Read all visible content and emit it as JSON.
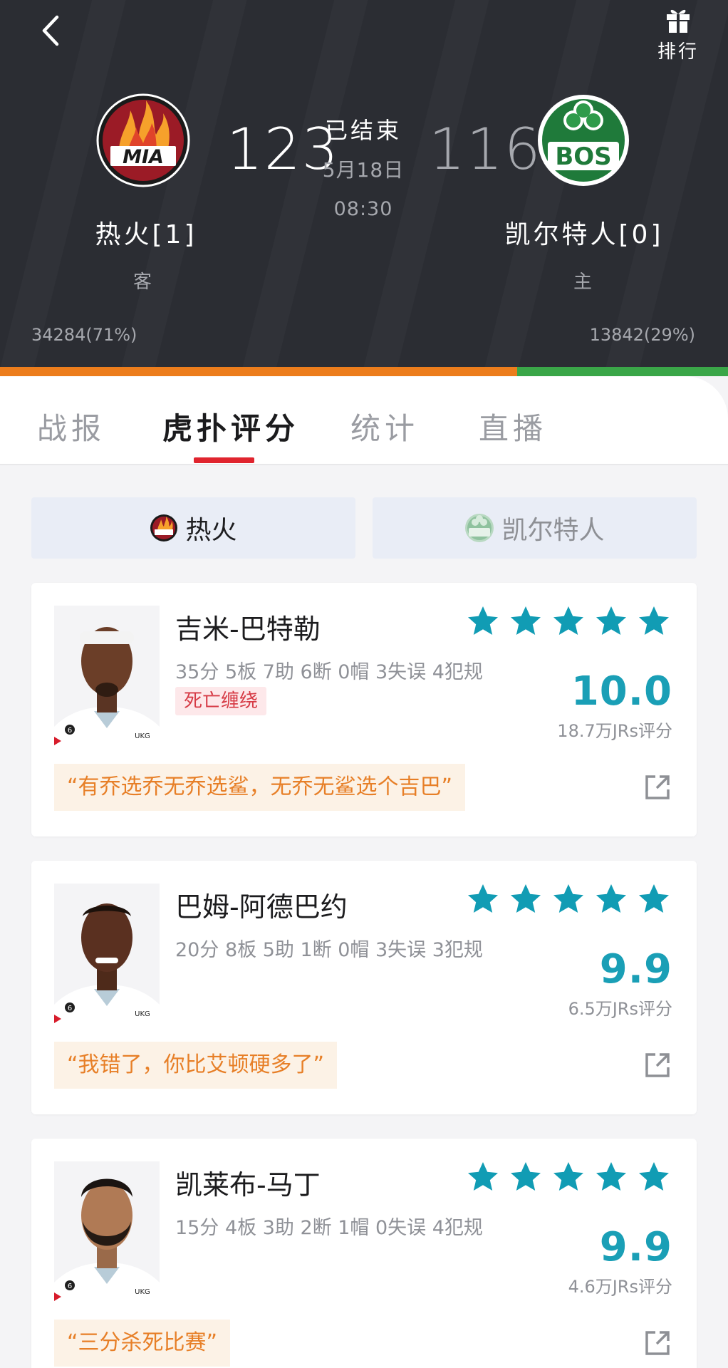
{
  "header": {
    "back_icon": "chevron-left-icon",
    "rank_icon": "gift-icon",
    "rank_label": "排行",
    "status": "已结束",
    "date": "5月18日",
    "time": "08:30",
    "home_team": {
      "name": "热火[1]",
      "side": "客",
      "score": "123",
      "logo_text": "MIA",
      "vote": "34284(71%)",
      "vote_share": 0.71,
      "color": "#ec7d1c"
    },
    "away_team": {
      "name": "凯尔特人[0]",
      "side": "主",
      "score": "116",
      "logo_text": "BOS",
      "vote": "13842(29%)",
      "vote_share": 0.29,
      "color": "#3aa648"
    }
  },
  "tabs": [
    {
      "label": "战报"
    },
    {
      "label": "虎扑评分"
    },
    {
      "label": "统计"
    },
    {
      "label": "直播"
    }
  ],
  "active_tab": "虎扑评分",
  "team_toggle": {
    "mia_label": "热火",
    "bos_label": "凯尔特人"
  },
  "colors": {
    "accent_red": "#e0242e",
    "score_teal": "#1a9fb6",
    "star_teal": "#119cb4",
    "quote_orange": "#e77f27"
  },
  "players": [
    {
      "name": "吉米-巴特勒",
      "stats": "35分 5板 7助 6断 0帽 3失误 4犯规",
      "tag": "死亡缠绕",
      "stars": 5,
      "score": "10.0",
      "rating_count": "18.7万JRs评分",
      "quote": "“有乔选乔无乔选鲨，无乔无鲨选个吉巴”"
    },
    {
      "name": "巴姆-阿德巴约",
      "stats": "20分 8板 5助 1断 0帽 3失误 3犯规",
      "stars": 5,
      "score": "9.9",
      "rating_count": "6.5万JRs评分",
      "quote": "“我错了，你比艾顿硬多了”"
    },
    {
      "name": "凯莱布-马丁",
      "stats": "15分 4板 3助 2断 1帽 0失误 4犯规",
      "stars": 5,
      "score": "9.9",
      "rating_count": "4.6万JRs评分",
      "quote": "“三分杀死比赛”"
    }
  ]
}
